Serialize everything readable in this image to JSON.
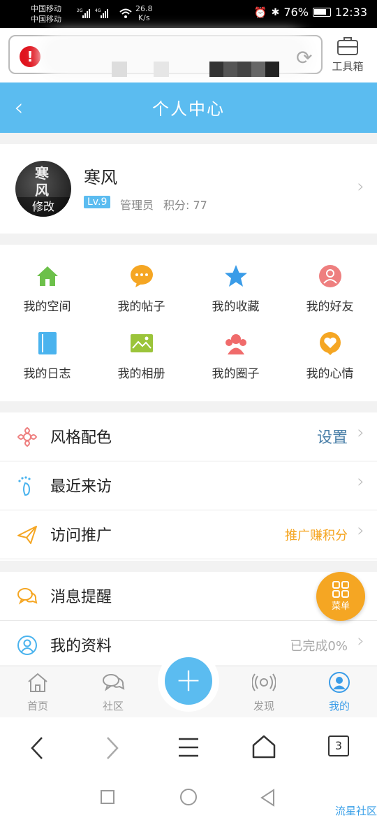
{
  "status_bar": {
    "carrier1": "中国移动",
    "carrier2": "中国移动",
    "net1": "2G",
    "net2": "4G",
    "speed_value": "26.8",
    "speed_unit": "K/s",
    "battery": "76%",
    "time": "12:33"
  },
  "browser": {
    "toolbox_label": "工具箱"
  },
  "header": {
    "title": "个人中心"
  },
  "profile": {
    "name": "寒风",
    "avatar_text": "寒风",
    "avatar_edit": "修改",
    "level": "Lv.9",
    "role": "管理员",
    "score": "积分: 77"
  },
  "grid": [
    {
      "label": "我的空间",
      "icon": "home-icon",
      "color": "#6cc04a"
    },
    {
      "label": "我的帖子",
      "icon": "chat-bubble-icon",
      "color": "#f5a623"
    },
    {
      "label": "我的收藏",
      "icon": "star-icon",
      "color": "#3a9ce8"
    },
    {
      "label": "我的好友",
      "icon": "friend-icon",
      "color": "#ee7f7f"
    },
    {
      "label": "我的日志",
      "icon": "notebook-icon",
      "color": "#4ab3ee"
    },
    {
      "label": "我的相册",
      "icon": "photo-icon",
      "color": "#9bc43a"
    },
    {
      "label": "我的圈子",
      "icon": "group-icon",
      "color": "#f06b6b"
    },
    {
      "label": "我的心情",
      "icon": "heart-bubble-icon",
      "color": "#f5a623"
    }
  ],
  "list1": [
    {
      "label": "风格配色",
      "value": "设置",
      "value_color": "#4a7fa8",
      "icon": "flower-icon"
    },
    {
      "label": "最近来访",
      "value": "",
      "icon": "footprint-icon"
    },
    {
      "label": "访问推广",
      "value": "推广赚积分",
      "value_color": "#f5a623",
      "icon": "paper-plane-icon"
    }
  ],
  "list2": [
    {
      "label": "消息提醒",
      "value": "",
      "icon": "message-icon"
    },
    {
      "label": "我的资料",
      "value": "已完成0%",
      "value_color": "#aaa",
      "icon": "profile-icon"
    }
  ],
  "menu_fab": {
    "label": "菜单"
  },
  "tabbar": [
    {
      "label": "首页",
      "icon": "home-outline-icon",
      "active": false
    },
    {
      "label": "社区",
      "icon": "community-icon",
      "active": false
    },
    {
      "label": "发现",
      "icon": "radar-icon",
      "active": false
    },
    {
      "label": "我的",
      "icon": "user-circle-icon",
      "active": true
    }
  ],
  "browser_nav": {
    "tabs_count": "3"
  },
  "watermark": "流星社区",
  "colors": {
    "accent": "#5bbcf0",
    "orange": "#f5a623"
  }
}
